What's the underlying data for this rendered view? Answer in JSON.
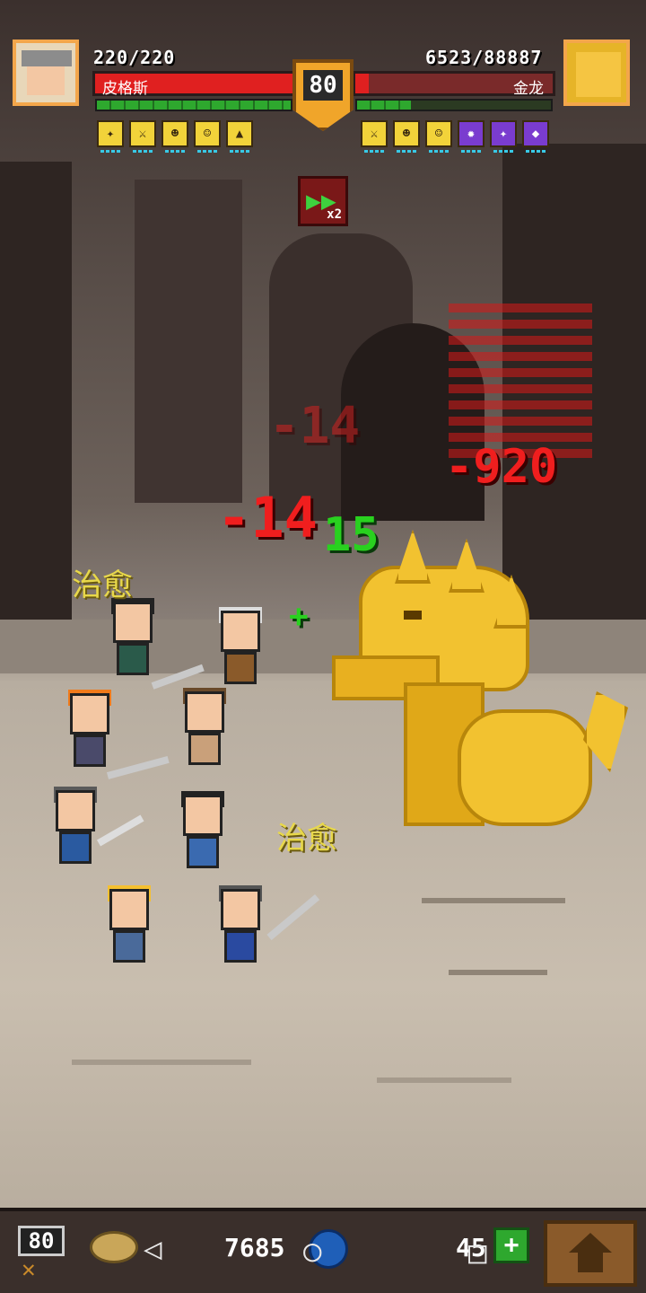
{
  "player": {
    "hp_text": "220/220",
    "name": "皮格斯"
  },
  "boss": {
    "hp_text": "6523/88887",
    "name": "金龙",
    "hp_fraction": 0.07
  },
  "level_badge": "80",
  "speed": {
    "multiplier": "x2"
  },
  "player_buffs": [
    "buff-1",
    "buff-2",
    "buff-3",
    "buff-4",
    "buff-5"
  ],
  "boss_buffs": [
    "buff-1",
    "buff-2",
    "buff-3",
    "buff-4",
    "buff-5",
    "buff-6"
  ],
  "floating_text": {
    "dmg_faded": "-14",
    "dmg_main": "-14",
    "heal_num": "15",
    "heal_label_1": "治愈",
    "heal_label_2": "治愈",
    "boss_dmg": "-920",
    "heal_small": "+"
  },
  "bottom": {
    "player_level": "80",
    "gold": "7685",
    "gems": "45",
    "plus": "+"
  },
  "colors": {
    "hp_red": "#e02020",
    "gold_dragon": "#f2c230",
    "heal_green": "#29d11f"
  }
}
